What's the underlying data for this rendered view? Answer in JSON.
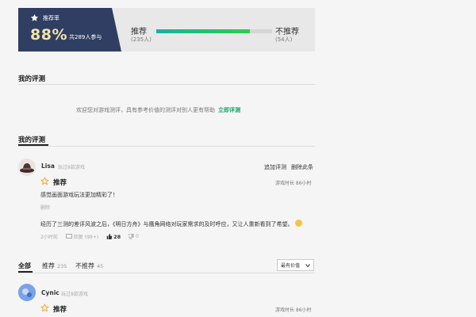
{
  "rating": {
    "label": "推荐率",
    "percent": "88%",
    "participants": "共289人参与",
    "recommend_label": "推荐",
    "recommend_count": "(235人)",
    "not_recommend_label": "不推荐",
    "not_recommend_count": "(54人)",
    "recommend_fraction": 0.81,
    "bar_colors": [
      "#14b3a0",
      "#2ccd4b"
    ]
  },
  "my_review_section": {
    "title": "我的评测",
    "invite_text": "欢迎您对游戏测评，具有参考价值的测评对别人更有帮助",
    "invite_link": "立即评测"
  },
  "my_review_list": {
    "title": "我的评测"
  },
  "review1": {
    "username": "Lisa",
    "subtitle": "玩过8款游戏",
    "action_add": "追加评测",
    "action_delete": "删除此条",
    "verdict": "推荐",
    "playtime": "游戏时长 86小时",
    "line1": "感觉画面游戏玩法更加精彩了！",
    "tag": "删除",
    "line2": "经历了三测的差评风波之后，《明日方舟》与鹰角网络对玩家需求的及时呼应，又让人重新看到了希望。",
    "time": "2小时前",
    "replies": "回复 (99+)",
    "likes": "28",
    "dislikes": "0"
  },
  "tabs": {
    "all": "全部",
    "recommend": "推荐",
    "recommend_count": "235",
    "not_recommend": "不推荐",
    "not_recommend_count": "45",
    "sort": "最有价值"
  },
  "review2": {
    "username": "Cynic",
    "subtitle": "玩过8款游戏",
    "verdict": "推荐",
    "playtime": "游戏时长 86小时"
  },
  "colors": {
    "accent_green": "#14a364",
    "header_navy": "#2f3e62",
    "percent_gold": "#f3e3a8",
    "star_orange": "#f0a02c"
  }
}
